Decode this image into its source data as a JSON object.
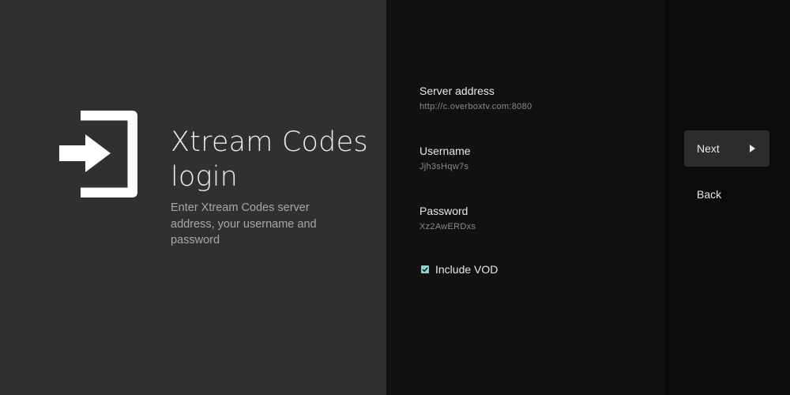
{
  "header": {
    "title": "Xtream Codes login",
    "description": "Enter Xtream Codes server address, your username and password",
    "icon": "login-icon"
  },
  "form": {
    "server": {
      "label": "Server address",
      "value": "http://c.overboxtv.com:8080"
    },
    "username": {
      "label": "Username",
      "value": "Jjh3sHqw7s"
    },
    "password": {
      "label": "Password",
      "value": "Xz2AwERDxs"
    },
    "include_vod": {
      "label": "Include VOD",
      "checked": true
    }
  },
  "actions": {
    "next_label": "Next",
    "back_label": "Back"
  },
  "colors": {
    "left_panel_bg": "#303030",
    "form_panel_bg": "#111111",
    "actions_panel_bg": "#0b0b0b",
    "checkbox_accent": "#8fd0c8",
    "focused_button_bg": "#2c2c2c"
  }
}
